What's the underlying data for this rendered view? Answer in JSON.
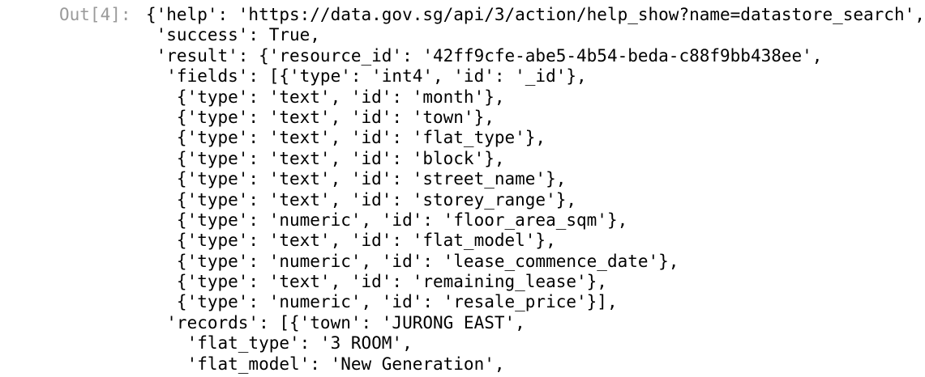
{
  "prompt": "Out[4]:",
  "lines": [
    "{'help': 'https://data.gov.sg/api/3/action/help_show?name=datastore_search',",
    " 'success': True,",
    " 'result': {'resource_id': '42ff9cfe-abe5-4b54-beda-c88f9bb438ee',",
    "  'fields': [{'type': 'int4', 'id': '_id'},",
    "   {'type': 'text', 'id': 'month'},",
    "   {'type': 'text', 'id': 'town'},",
    "   {'type': 'text', 'id': 'flat_type'},",
    "   {'type': 'text', 'id': 'block'},",
    "   {'type': 'text', 'id': 'street_name'},",
    "   {'type': 'text', 'id': 'storey_range'},",
    "   {'type': 'numeric', 'id': 'floor_area_sqm'},",
    "   {'type': 'text', 'id': 'flat_model'},",
    "   {'type': 'numeric', 'id': 'lease_commence_date'},",
    "   {'type': 'text', 'id': 'remaining_lease'},",
    "   {'type': 'numeric', 'id': 'resale_price'}],",
    "  'records': [{'town': 'JURONG EAST',",
    "    'flat_type': '3 ROOM',",
    "    'flat_model': 'New Generation',"
  ]
}
